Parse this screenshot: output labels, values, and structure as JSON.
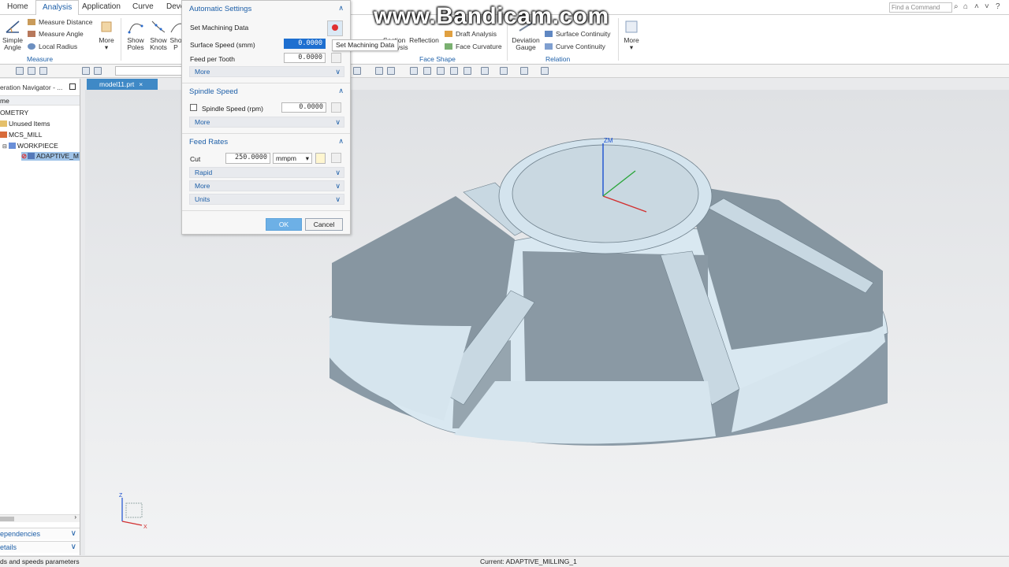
{
  "watermark": "www.Bandicam.com",
  "menubar": {
    "tabs": [
      "Home",
      "Analysis",
      "Application",
      "Curve",
      "Deve"
    ],
    "active": "Analysis",
    "find_command_placeholder": "Find a Command"
  },
  "ribbon": {
    "simple_angle": "Simple\nAngle",
    "measure_distance": "Measure Distance",
    "measure_angle": "Measure Angle",
    "local_radius": "Local Radius",
    "more": "More",
    "show_poles": "Show\nPoles",
    "show_knots": "Show\nKnots",
    "sho_p": "Sho\nP",
    "section_analysis": "Section\nAnalysis",
    "reflection": "Reflection",
    "draft_analysis": "Draft Analysis",
    "face_curvature": "Face Curvature",
    "deviation_gauge": "Deviation\nGauge",
    "surface_continuity": "Surface Continuity",
    "curve_continuity": "Curve Continuity",
    "more2": "More",
    "group_measure": "Measure",
    "group_face_shape": "Face Shape",
    "group_relation": "Relation"
  },
  "navigator": {
    "title": "eration Navigator - ...",
    "column": "me",
    "items": [
      {
        "label": "OMETRY"
      },
      {
        "label": "Unused Items"
      },
      {
        "label": "MCS_MILL"
      },
      {
        "label": "WORKPIECE"
      },
      {
        "label": "ADAPTIVE_M"
      }
    ],
    "dependencies": "ependencies",
    "details": "etails"
  },
  "graphics": {
    "tab_label": "model11.prt",
    "axis_zm": "ZM",
    "axis_z": "Z",
    "axis_x": "X"
  },
  "status": {
    "left": "ds and speeds parameters",
    "center": "Current: ADAPTIVE_MILLING_1"
  },
  "dialog": {
    "automatic_settings": {
      "title": "Automatic Settings",
      "set_machining_data": "Set Machining Data",
      "surface_speed_label": "Surface Speed (smm)",
      "surface_speed_value": "0.0000",
      "feed_per_tooth_label": "Feed per Tooth",
      "feed_per_tooth_value": "0.0000",
      "more": "More"
    },
    "tooltip": "Set Machining Data",
    "spindle_speed": {
      "title": "Spindle Speed",
      "label": "Spindle Speed (rpm)",
      "value": "0.0000",
      "more": "More"
    },
    "feed_rates": {
      "title": "Feed Rates",
      "cut_label": "Cut",
      "cut_value": "250.0000",
      "cut_unit": "mmpm",
      "rapid": "Rapid",
      "more": "More",
      "units": "Units"
    },
    "ok": "OK",
    "cancel": "Cancel"
  },
  "colors": {
    "accent": "#1d5fa8",
    "part_top": "#d9e8f1",
    "part_side": "#8c9ba6",
    "highlight": "#1e6fd0"
  }
}
